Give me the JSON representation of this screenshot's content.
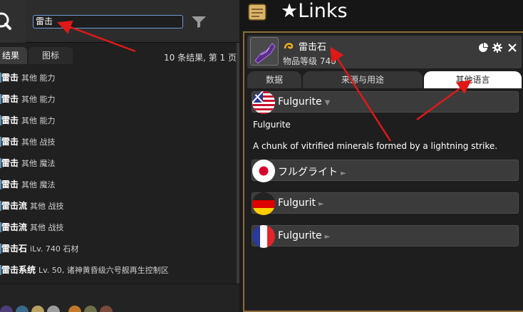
{
  "search": {
    "value": "雷击"
  },
  "left_tabs": {
    "results": "结果",
    "icons": "图标"
  },
  "results_count": "10 条结果, 第 1 页",
  "results": [
    {
      "name": "雷击",
      "meta": "其他 能力"
    },
    {
      "name": "雷击",
      "meta": "其他 能力"
    },
    {
      "name": "雷击",
      "meta": "其他 能力"
    },
    {
      "name": "雷击",
      "meta": "其他 战技"
    },
    {
      "name": "雷击",
      "meta": "其他 魔法"
    },
    {
      "name": "雷击",
      "meta": "其他 魔法"
    },
    {
      "name": "雷击流",
      "meta": "其他 战技"
    },
    {
      "name": "雷击流",
      "meta": "其他 战技"
    },
    {
      "name": "雷击石",
      "meta": "iLv. 740 石材"
    },
    {
      "name": "雷击系统",
      "meta": "Lv. 50, 诸神黄昏级六号舰再生控制区"
    }
  ],
  "links": {
    "title": "★Links"
  },
  "item": {
    "name": "雷击石",
    "level": "物品等级 740"
  },
  "right_tabs": {
    "data": "数据",
    "sources": "来源与用途",
    "languages": "其他语言"
  },
  "languages": {
    "en": {
      "name": "Fulgurite",
      "arrow": "▼"
    },
    "en_name": "Fulgurite",
    "en_desc": "A chunk of vitrified minerals formed by a lightning strike.",
    "ja": {
      "name": "フルグライト",
      "arrow": "►"
    },
    "de": {
      "name": "Fulgurit",
      "arrow": "►"
    },
    "fr": {
      "name": "Fulgurite",
      "arrow": "►"
    }
  },
  "colors": {
    "accent_border": "#8b6d3a",
    "annotation_arrow": "#e01818",
    "input_focus": "#6f9ad8"
  }
}
